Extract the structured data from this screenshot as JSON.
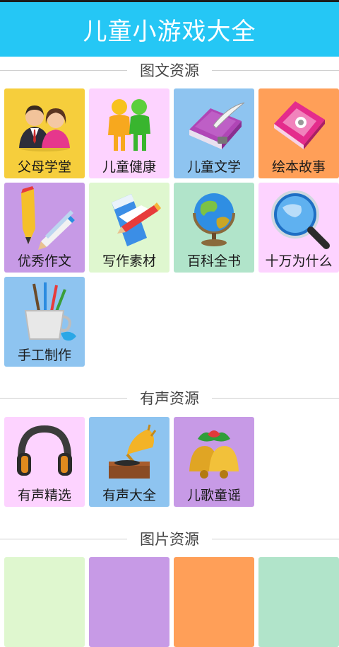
{
  "header": {
    "title": "儿童小游戏大全"
  },
  "sections": [
    {
      "title": "图文资源",
      "items": [
        {
          "label": "父母学堂",
          "icon": "parents-icon",
          "color": "#f6ce3c"
        },
        {
          "label": "儿童健康",
          "icon": "kids-icon",
          "color": "#fdd3ff"
        },
        {
          "label": "儿童文学",
          "icon": "book-icon",
          "color": "#8ec4f0"
        },
        {
          "label": "绘本故事",
          "icon": "notebook-icon",
          "color": "#ff9f58"
        },
        {
          "label": "优秀作文",
          "icon": "pencils-icon",
          "color": "#c79ae6"
        },
        {
          "label": "写作素材",
          "icon": "paper-pencil-icon",
          "color": "#dff7cf"
        },
        {
          "label": "百科全书",
          "icon": "globe-icon",
          "color": "#b1e4ca"
        },
        {
          "label": "十万为什么",
          "icon": "magnifier-icon",
          "color": "#fdd3ff"
        },
        {
          "label": "手工制作",
          "icon": "brush-cup-icon",
          "color": "#8ec4f0"
        }
      ]
    },
    {
      "title": "有声资源",
      "items": [
        {
          "label": "有声精选",
          "icon": "headphones-icon",
          "color": "#fdd3ff"
        },
        {
          "label": "有声大全",
          "icon": "gramophone-icon",
          "color": "#8ec4f0"
        },
        {
          "label": "儿歌童谣",
          "icon": "bells-icon",
          "color": "#c79ae6"
        }
      ]
    },
    {
      "title": "图片资源",
      "items": [
        {
          "color": "#dff7cf"
        },
        {
          "color": "#c79ae6"
        },
        {
          "color": "#ff9f58"
        },
        {
          "color": "#b1e4ca"
        }
      ]
    }
  ]
}
